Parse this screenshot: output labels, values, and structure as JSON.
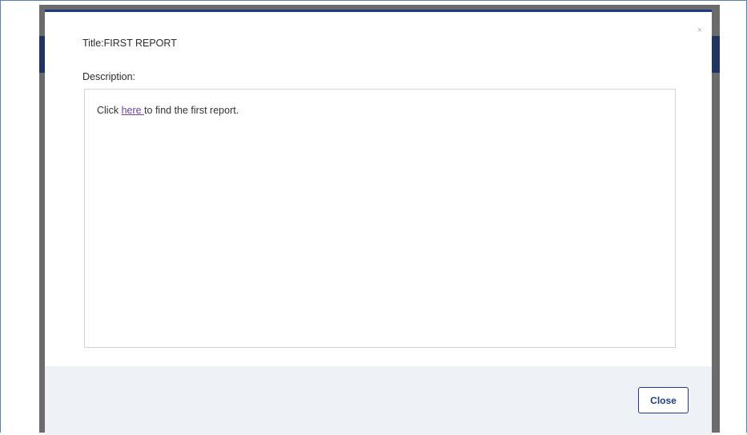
{
  "modal": {
    "title": "Title:FIRST REPORT",
    "close_x": "×",
    "description_label": "Description:",
    "description": {
      "before_link": "Click ",
      "link_text": "here ",
      "after_link": "to find the first report."
    },
    "close_button_label": "Close"
  },
  "colors": {
    "accent": "#1f3a8a",
    "header": "#1f3461",
    "backdrop": "#6b6b6b",
    "footer": "#eef1f5",
    "link": "#6a3fb0",
    "frame": "#5b7fb5"
  }
}
